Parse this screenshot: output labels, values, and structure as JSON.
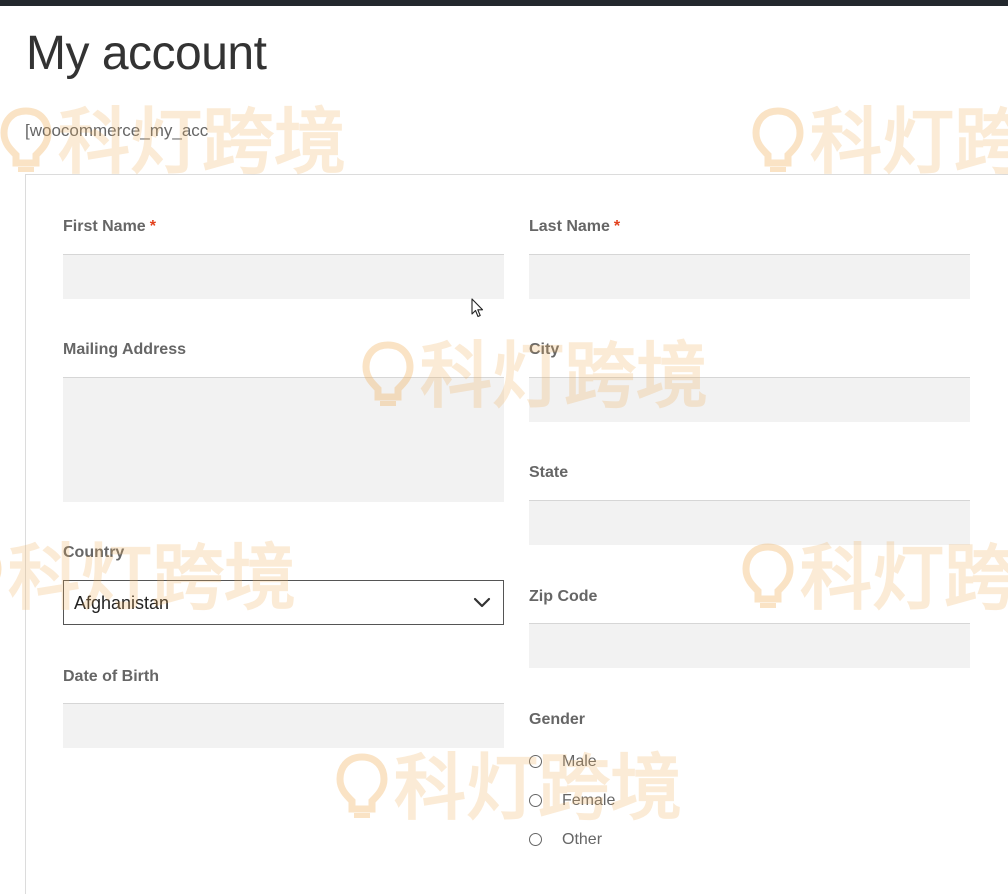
{
  "page": {
    "title": "My account",
    "shortcode": "[woocommerce_my_acc"
  },
  "form": {
    "first_name": {
      "label": "First Name",
      "required": "*",
      "value": ""
    },
    "last_name": {
      "label": "Last Name",
      "required": "*",
      "value": ""
    },
    "mailing_address": {
      "label": "Mailing Address",
      "value": ""
    },
    "city": {
      "label": "City",
      "value": ""
    },
    "state": {
      "label": "State",
      "value": ""
    },
    "country": {
      "label": "Country",
      "selected": "Afghanistan"
    },
    "zip_code": {
      "label": "Zip Code",
      "value": ""
    },
    "date_of_birth": {
      "label": "Date of Birth",
      "value": ""
    },
    "gender": {
      "label": "Gender",
      "options": [
        "Male",
        "Female",
        "Other"
      ]
    }
  },
  "watermark": {
    "text": "科灯跨境"
  },
  "colors": {
    "topbar": "#23282d",
    "required": "#e2401c",
    "input_bg": "#f2f2f2",
    "watermark": "#f0af5a"
  },
  "icons": {
    "select_arrow": "chevron-down-icon",
    "cursor": "mouse-pointer-icon",
    "watermark_logo": "lightbulb-logo-icon"
  }
}
